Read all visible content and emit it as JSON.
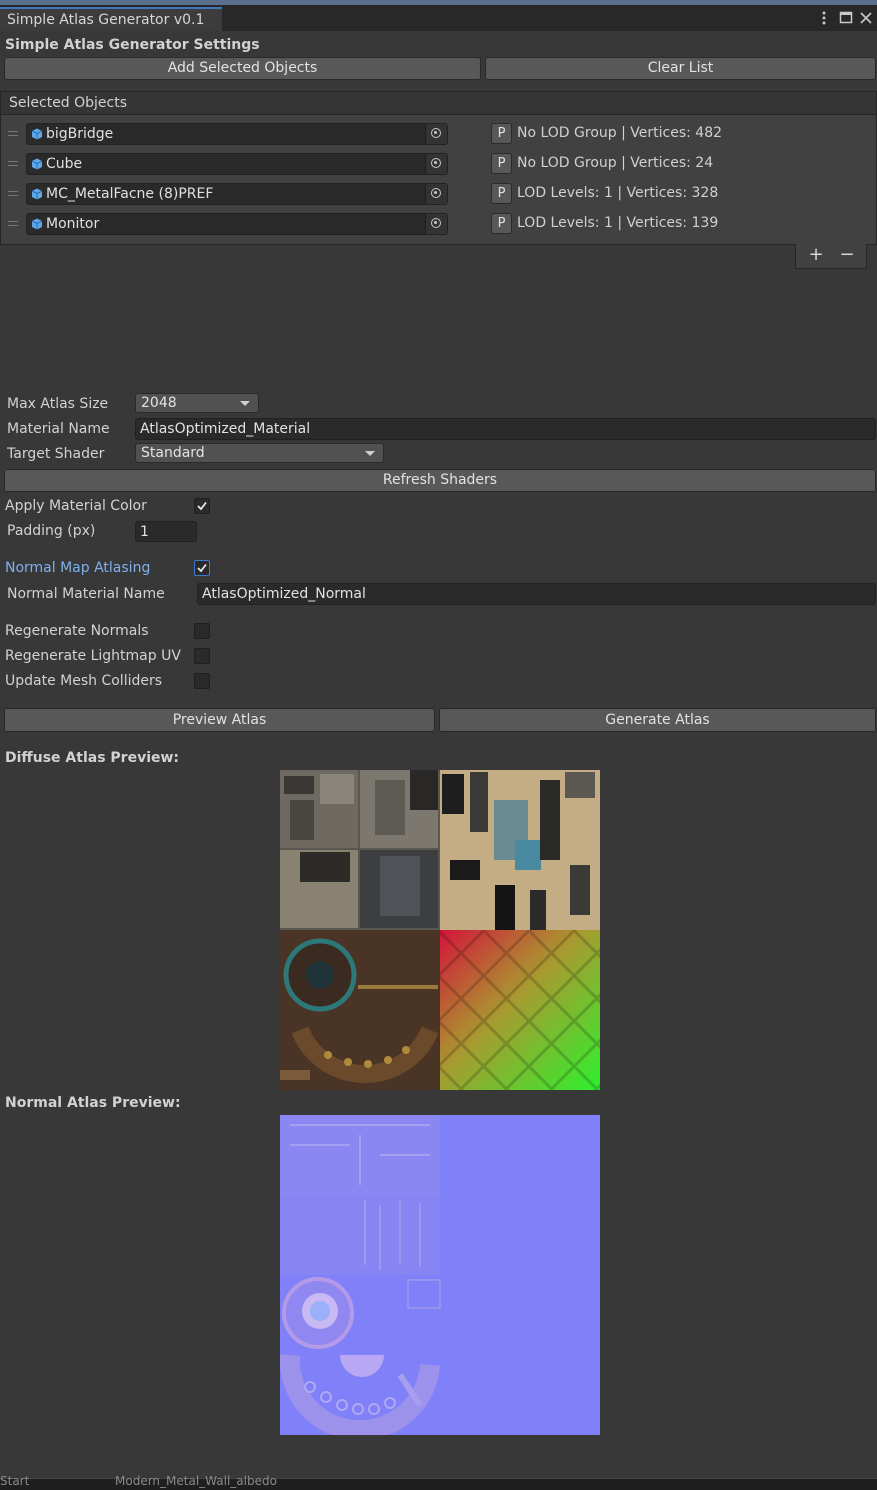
{
  "window": {
    "tab_title": "Simple Atlas Generator v0.1",
    "menu_icon": "kebab-menu-icon",
    "maximize_icon": "maximize-icon",
    "close_icon": "close-icon"
  },
  "settings": {
    "title": "Simple Atlas Generator Settings",
    "add_selected_label": "Add Selected Objects",
    "clear_list_label": "Clear List"
  },
  "selected_objects": {
    "header": "Selected Objects",
    "items": [
      {
        "name": "bigBridge",
        "p": "P",
        "info": "No LOD Group | Vertices: 482"
      },
      {
        "name": "Cube",
        "p": "P",
        "info": "No LOD Group | Vertices: 24"
      },
      {
        "name": "MC_MetalFacne (8)PREF",
        "p": "P",
        "info": "LOD Levels: 1 | Vertices: 328"
      },
      {
        "name": "Monitor",
        "p": "P",
        "info": "LOD Levels: 1 | Vertices: 139"
      }
    ],
    "add_label": "+",
    "remove_label": "−"
  },
  "form": {
    "max_atlas_size_label": "Max Atlas Size",
    "max_atlas_size_value": "2048",
    "material_name_label": "Material Name",
    "material_name_value": "AtlasOptimized_Material",
    "target_shader_label": "Target Shader",
    "target_shader_value": "Standard",
    "refresh_shaders_label": "Refresh Shaders",
    "apply_material_color_label": "Apply Material Color",
    "apply_material_color": true,
    "padding_label": "Padding (px)",
    "padding_value": "1",
    "normal_map_atlasing_label": "Normal Map Atlasing",
    "normal_map_atlasing": true,
    "normal_material_name_label": "Normal Material Name",
    "normal_material_name_value": "AtlasOptimized_Normal",
    "regenerate_normals_label": "Regenerate Normals",
    "regenerate_normals": false,
    "regenerate_lightmap_uv_label": "Regenerate Lightmap UV",
    "regenerate_lightmap_uv": false,
    "update_mesh_colliders_label": "Update Mesh Colliders",
    "update_mesh_colliders": false
  },
  "actions": {
    "preview_atlas_label": "Preview Atlas",
    "generate_atlas_label": "Generate Atlas"
  },
  "previews": {
    "diffuse_label": "Diffuse Atlas Preview:",
    "normal_label": "Normal Atlas Preview:"
  },
  "status_bar": {
    "left_text": "Start",
    "middle_text": "Modern_Metal_Wall_albedo"
  },
  "colors": {
    "background": "#383838",
    "accent": "#3a79bb",
    "normal_map": "#8080f8",
    "blue_label": "#7fb0ec"
  }
}
